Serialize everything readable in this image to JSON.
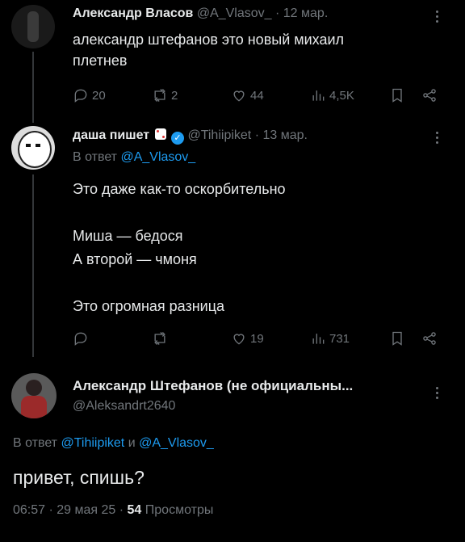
{
  "tweet1": {
    "name": "Александр Власов",
    "handle": "@A_Vlasov_",
    "date": "· 12 мар.",
    "text_line1": "александр штефанов это новый михаил",
    "text_line2": "плетнев",
    "replies": "20",
    "retweets": "2",
    "likes": "44",
    "views": "4,5K"
  },
  "tweet2": {
    "name": "даша пишет",
    "handle": "@Tihiipiket",
    "date": "· 13 мар.",
    "reply_prefix": "В ответ",
    "reply_to": "@A_Vlasov_",
    "line1": "Это даже как-то оскорбительно",
    "line2": "Миша — бедося",
    "line3": "А второй — чмоня",
    "line4": "Это огромная разница",
    "replies": "",
    "retweets": "",
    "likes": "19",
    "views": "731"
  },
  "tweet3": {
    "name": "Александр Штефанов (не официальны...",
    "handle": "@Aleksandrt2640",
    "reply_prefix": "В ответ",
    "reply_to1": "@Tihiipiket",
    "reply_and": "и",
    "reply_to2": "@A_Vlasov_",
    "text": "привет, спишь?",
    "time": "06:57 · 29 мая 25 ·",
    "views_count": "54",
    "views_label": "Просмотры"
  },
  "colors": {
    "background": "#000000",
    "text": "#e7e9ea",
    "muted": "#71767b",
    "link": "#1d9bf0"
  }
}
